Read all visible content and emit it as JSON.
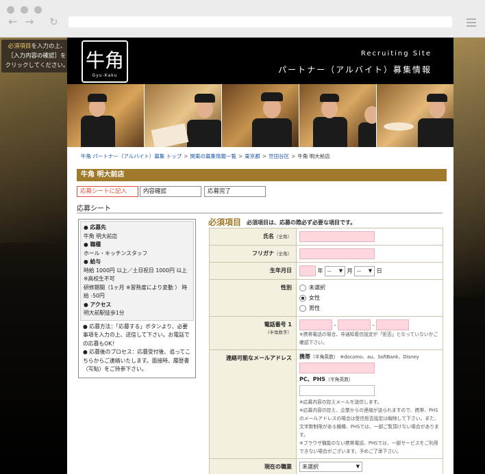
{
  "sidenote": {
    "line1_em": "必須項目",
    "line1": "を入力の上、",
    "line2_em": "［入力内容の確認］",
    "line2": "を",
    "line3": "クリックしてください。"
  },
  "header": {
    "logo_text": "牛角",
    "logo_sub": "Gyu-Kaku",
    "recruiting": "Recruiting Site",
    "title": "パートナー（アルバイト）募集情報"
  },
  "breadcrumb": {
    "items": [
      "牛角 パートナー（アルバイト）募集 トップ",
      "関東の募集情報一覧",
      "東京都",
      "世田谷区"
    ],
    "current": "牛角 明大前店",
    "separator": ">"
  },
  "store_name": "牛角 明大前店",
  "steps": [
    "応募シートに記入",
    "内容確認",
    "応募完了"
  ],
  "section_title": "応募シート",
  "info": {
    "dest_label": "● 応募先",
    "dest_value": "牛角 明大前店",
    "job_label": "● 職種",
    "job_value": "ホール・キッチンスタッフ",
    "pay_label": "● 給与",
    "pay_value1": "時給 1000円 以上／土日祝日 1000円 以上",
    "pay_value2": "※高校生不可",
    "pay_value3": "研修期間（1ヶ月 ※習熟度により変動 ） 時給 -50円",
    "access_label": "● アクセス",
    "access_value": "明大前駅徒歩1分",
    "note1": "● 応募方法：「応募する」ボタンより、必要事項を入力の上、送信して下さい。お電話での応募もOK！",
    "note2": "● 応募後のプロセス：応募受付後、追ってこちらからご連絡いたします。面接時、履歴書（写貼）をご持参下さい。"
  },
  "required": {
    "title": "必須項目",
    "desc": "必須項目は、応募の際必ず必要な項目です。"
  },
  "form": {
    "name_label": "氏名",
    "name_sub": "（全角）",
    "kana_label": "フリガナ",
    "kana_sub": "（全角）",
    "dob_label": "生年月日",
    "dob_year_unit": "年",
    "dob_month_unit": "月",
    "dob_day_unit": "日",
    "dob_month_value": "--",
    "dob_day_value": "--",
    "gender_label": "性別",
    "gender_options": [
      "未選択",
      "女性",
      "男性"
    ],
    "gender_selected": "女性",
    "phone_label": "電話番号 1",
    "phone_sub": "（半角数字）",
    "phone_dash": "-",
    "phone_note": "※携帯電話の場合、非通知着信設定が「拒否」となっていないかご確認下さい。",
    "email_label": "連絡可能なメールアドレス",
    "mobile_label": "携帯",
    "mobile_sub": "（半角英数）",
    "mobile_carriers": "※docomo、au、SoftBank、Disney",
    "pc_label": "PC、PHS",
    "pc_sub": "（半角英数）",
    "email_note1": "※応募内容の控えメールを送信します。",
    "email_note2": "※応募内容の控え、企業からの連絡が送られますので、携帯、PHSのメールアドレスの場合は受信拒否設定は解除して下さい。また、文字数制限がある機種、PHSでは、一部ご覧頂けない場合があります。",
    "email_note3": "※ブラウザ機能のない携帯電話、PHSでは、一部サービスをご利用できない場合がございます。予めご了承下さい。",
    "job_label": "現在の職業",
    "job_value": "未選択"
  }
}
